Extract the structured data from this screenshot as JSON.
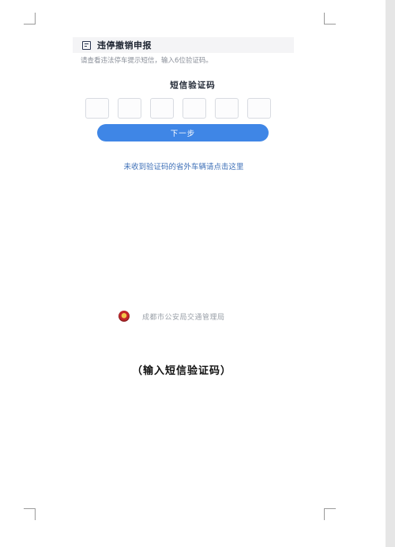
{
  "app": {
    "title": "违停撤销申报",
    "title_icon": "document-icon"
  },
  "form": {
    "instruction": "请查看违法停车提示短信，输入6位验证码。",
    "code_title": "短信验证码",
    "code_box_count": 6,
    "next_button_label": "下一步",
    "help_link": "未收到验证码的省外车辆请点击这里"
  },
  "footer": {
    "authority": "成都市公安局交通管理局",
    "emblem_icon": "police-emblem-icon"
  },
  "caption": "（输入短信验证码）",
  "colors": {
    "primary_button": "#3f86e6",
    "link": "#3d6fb7",
    "header_bg": "#f4f4f6"
  }
}
